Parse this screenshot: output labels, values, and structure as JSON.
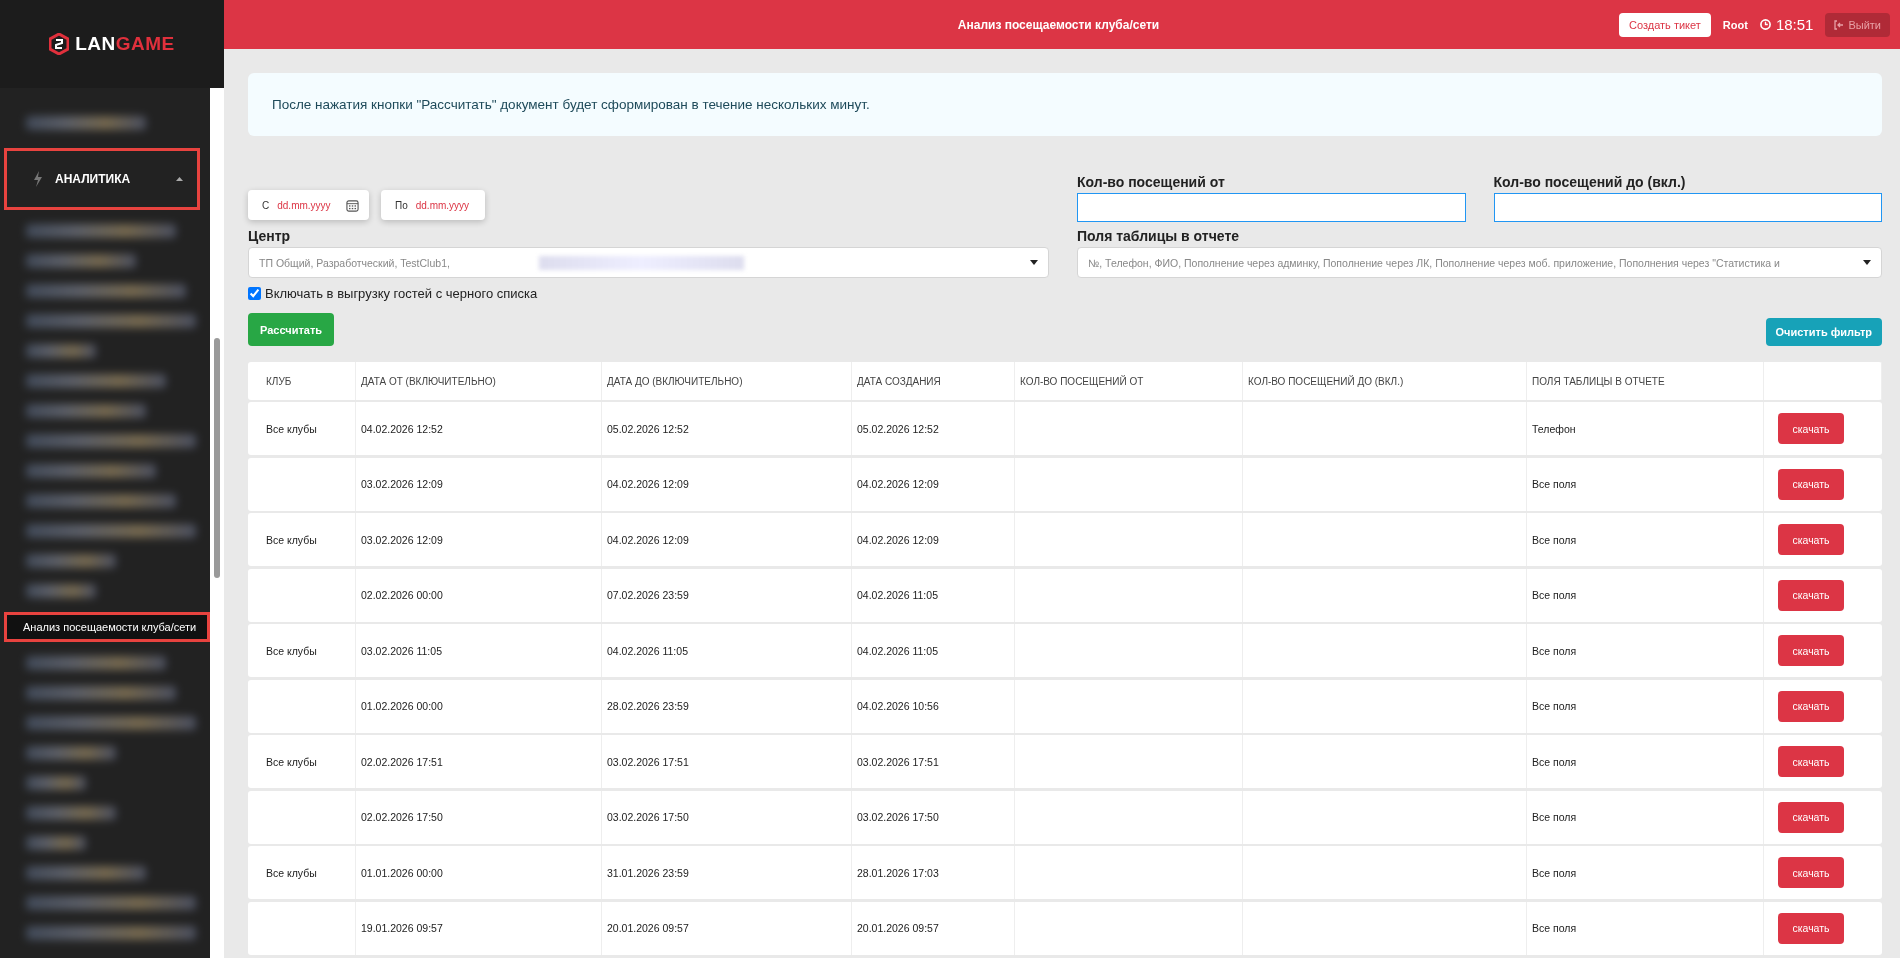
{
  "logo": {
    "text": "LAN",
    "accent": "GAME"
  },
  "sidebar": {
    "section": {
      "label": "АНАЛИТИКА",
      "expanded": true,
      "highlighted": true
    },
    "active_item": {
      "label": "Анализ посещаемости клуба/сети",
      "selected": true,
      "highlighted": true
    }
  },
  "header": {
    "title": "Анализ посещаемости клуба/сети",
    "create_ticket": "Создать тикет",
    "user": "Root",
    "time": "18:51",
    "logout": "Выйти"
  },
  "notice": "После нажатия кнопки \"Рассчитать\" документ будет сформирован в течение нескольких минут.",
  "filters": {
    "date_from": {
      "label": "С",
      "placeholder": "dd.mm.yyyy"
    },
    "date_to": {
      "label": "По",
      "placeholder": "dd.mm.yyyy"
    },
    "visits_from": {
      "label": "Кол-во посещений от"
    },
    "visits_to": {
      "label": "Кол-во посещений до (вкл.)"
    },
    "center": {
      "label": "Центр",
      "value": "ТП Общий, Разработческий, TestClub1,"
    },
    "table_fields": {
      "label": "Поля таблицы в отчете",
      "value": "№, Телефон, ФИО, Пополнение через админку, Пополнение через ЛК, Пополнение через моб. приложение, Пополнения через \"Статистика и"
    },
    "blacklist": {
      "label": "Включать в выгрузку гостей с черного списка",
      "checked": true
    },
    "calculate": "Рассчитать",
    "clear": "Очистить фильтр"
  },
  "table": {
    "columns": [
      "КЛУБ",
      "ДАТА ОТ (ВКЛЮЧИТЕЛЬНО)",
      "ДАТА ДО (ВКЛЮЧИТЕЛЬНО)",
      "ДАТА СОЗДАНИЯ",
      "КОЛ-ВО ПОСЕЩЕНИЙ ОТ",
      "КОЛ-ВО ПОСЕЩЕНИЙ ДО (ВКЛ.)",
      "ПОЛЯ ТАБЛИЦЫ В ОТЧЕТЕ"
    ],
    "rows": [
      {
        "club": "Все клубы",
        "date_from": "04.02.2026 12:52",
        "date_to": "05.02.2026 12:52",
        "created": "05.02.2026 12:52",
        "fields": "Телефон",
        "action": "скачать"
      },
      {
        "date_from": "03.02.2026 12:09",
        "date_to": "04.02.2026 12:09",
        "created": "04.02.2026 12:09",
        "fields": "Все поля",
        "action": "скачать"
      },
      {
        "club": "Все клубы",
        "date_from": "03.02.2026 12:09",
        "date_to": "04.02.2026 12:09",
        "created": "04.02.2026 12:09",
        "fields": "Все поля",
        "action": "скачать"
      },
      {
        "date_from": "02.02.2026 00:00",
        "date_to": "07.02.2026 23:59",
        "created": "04.02.2026 11:05",
        "fields": "Все поля",
        "action": "скачать"
      },
      {
        "club": "Все клубы",
        "date_from": "03.02.2026 11:05",
        "date_to": "04.02.2026 11:05",
        "created": "04.02.2026 11:05",
        "fields": "Все поля",
        "action": "скачать"
      },
      {
        "date_from": "01.02.2026 00:00",
        "date_to": "28.02.2026 23:59",
        "created": "04.02.2026 10:56",
        "fields": "Все поля",
        "action": "скачать"
      },
      {
        "club": "Все клубы",
        "date_from": "02.02.2026 17:51",
        "date_to": "03.02.2026 17:51",
        "created": "03.02.2026 17:51",
        "fields": "Все поля",
        "action": "скачать"
      },
      {
        "date_from": "02.02.2026 17:50",
        "date_to": "03.02.2026 17:50",
        "created": "03.02.2026 17:50",
        "fields": "Все поля",
        "action": "скачать"
      },
      {
        "club": "Все клубы",
        "date_from": "01.01.2026 00:00",
        "date_to": "31.01.2026 23:59",
        "created": "28.01.2026 17:03",
        "fields": "Все поля",
        "action": "скачать"
      },
      {
        "date_from": "19.01.2026 09:57",
        "date_to": "20.01.2026 09:57",
        "created": "20.01.2026 09:57",
        "fields": "Все поля",
        "action": "скачать"
      }
    ]
  }
}
